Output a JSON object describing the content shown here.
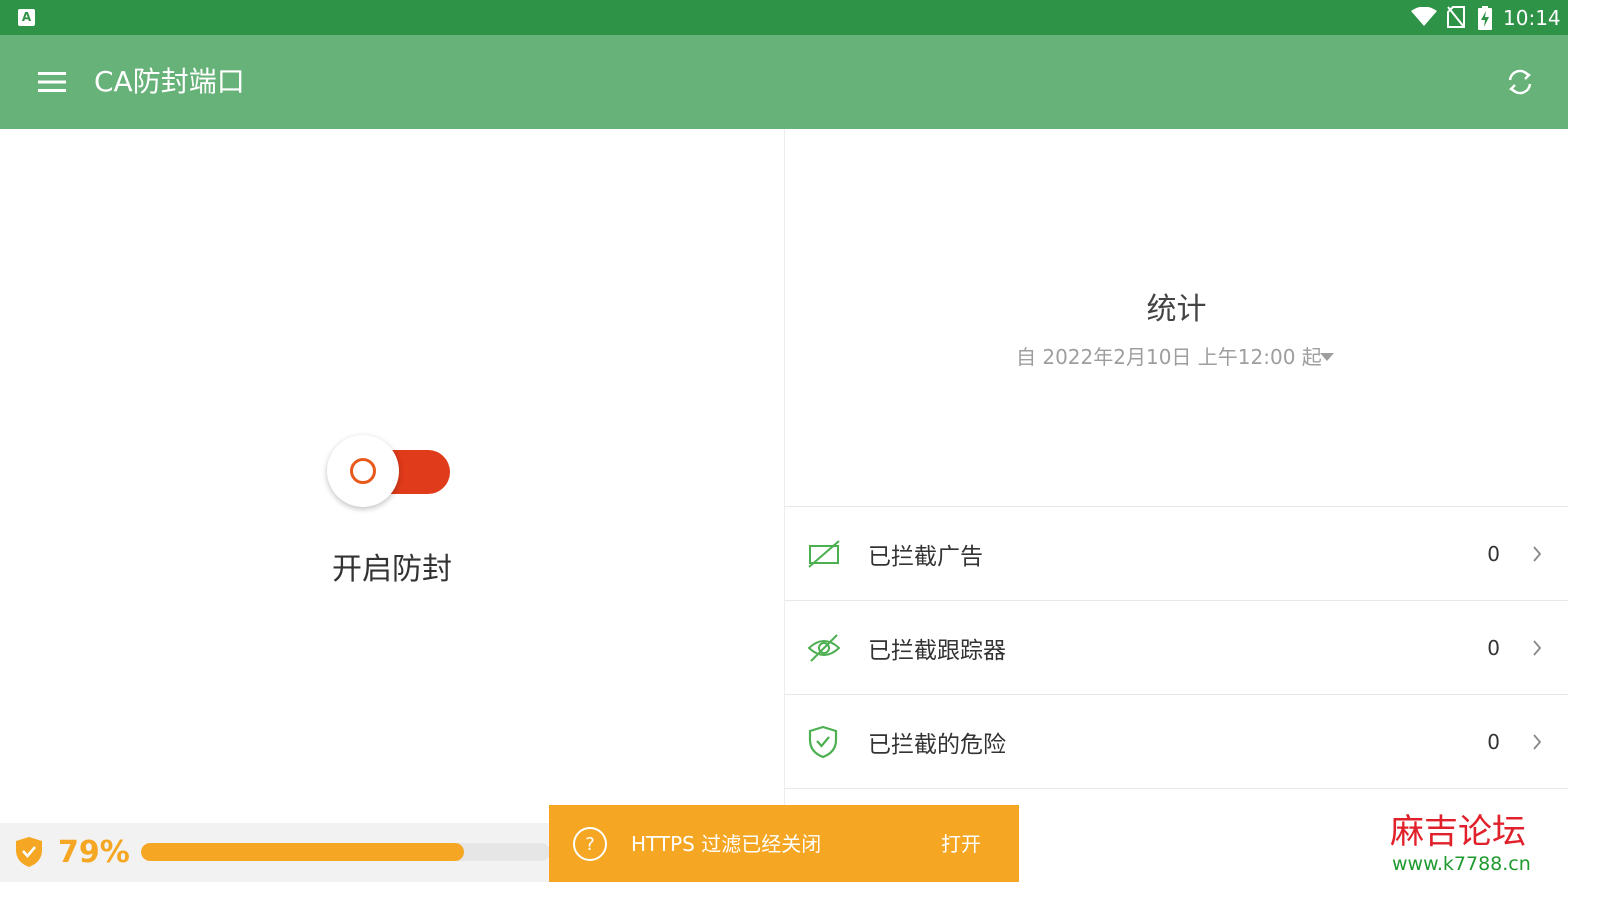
{
  "status_bar": {
    "time": "10:14"
  },
  "app_bar": {
    "title": "CA防封端口"
  },
  "protection": {
    "toggle_label": "开启防封"
  },
  "stats": {
    "title": "统计",
    "since": "自 2022年2月10日 上午12:00 起",
    "rows": [
      {
        "label": "已拦截广告",
        "count": "0"
      },
      {
        "label": "已拦截跟踪器",
        "count": "0"
      },
      {
        "label": "已拦截的危险",
        "count": "0"
      }
    ]
  },
  "bottom_bar": {
    "percent_label": "79%",
    "progress": 0.79
  },
  "snackbar": {
    "message": "HTTPS 过滤已经关闭",
    "action": "打开"
  },
  "watermark": {
    "title": "麻吉论坛",
    "url": "www.k7788.cn"
  },
  "colors": {
    "status_bar": "#2f9347",
    "app_bar": "#67b279",
    "accent_green": "#4caf50",
    "toggle_red": "#e03b1a",
    "toggle_ring": "#e85a1c",
    "warning_orange": "#f5a623",
    "watermark_red": "#e0202a",
    "watermark_green": "#1f9a2e"
  }
}
